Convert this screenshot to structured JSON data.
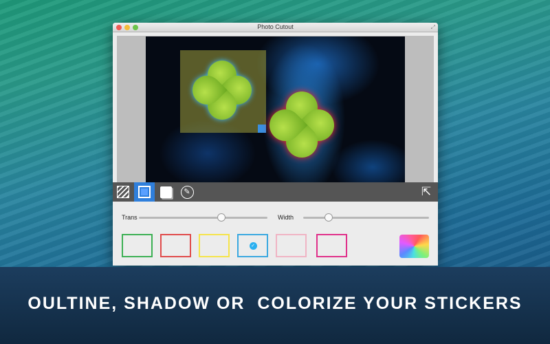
{
  "window": {
    "title": "Photo Cutout"
  },
  "toolbar": {
    "tools": [
      "stripes-tool",
      "outline-tool",
      "shadow-tool",
      "colorize-tool"
    ],
    "active": "outline-tool"
  },
  "controls": {
    "trans": {
      "label": "Trans",
      "value": 0.64
    },
    "width": {
      "label": "Width",
      "value": 0.2
    },
    "swatches": [
      {
        "name": "green",
        "color": "#3cb054",
        "selected": false
      },
      {
        "name": "red",
        "color": "#e04a4a",
        "selected": false
      },
      {
        "name": "yellow",
        "color": "#f5e44a",
        "selected": false
      },
      {
        "name": "blue",
        "color": "#3aa8e0",
        "selected": true
      },
      {
        "name": "pink",
        "color": "#f0b4c4",
        "selected": false
      },
      {
        "name": "magenta",
        "color": "#e0308a",
        "selected": false
      }
    ]
  },
  "banner": {
    "text": "OULTINE, SHADOW OR  COLORIZE YOUR STICKERS"
  }
}
